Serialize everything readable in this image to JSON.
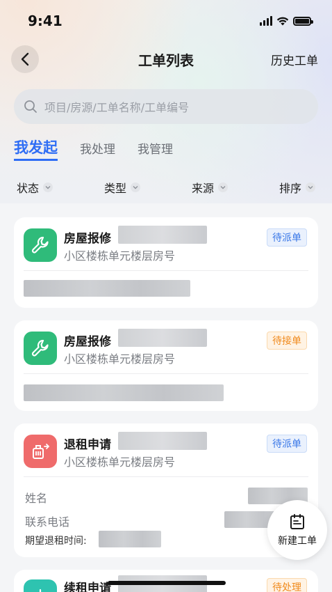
{
  "status_bar": {
    "time": "9:41"
  },
  "nav": {
    "title": "工单列表",
    "history": "历史工单"
  },
  "search": {
    "placeholder": "项目/房源/工单名称/工单编号"
  },
  "tabs": [
    "我发起",
    "我处理",
    "我管理"
  ],
  "filters": [
    "状态",
    "类型",
    "来源",
    "排序"
  ],
  "cards": [
    {
      "title": "房屋报修",
      "subtitle": "小区楼栋单元楼层房号",
      "status": "待派单",
      "icon": "wrench-icon"
    },
    {
      "title": "房屋报修",
      "subtitle": "小区楼栋单元楼层房号",
      "status": "待接单",
      "icon": "wrench-icon"
    },
    {
      "title": "退租申请",
      "subtitle": "小区楼栋单元楼层房号",
      "status": "待派单",
      "icon": "move-out-icon",
      "fields": {
        "name": "姓名",
        "phone": "联系电话",
        "expected_date": "期望退租时间:"
      }
    },
    {
      "title": "续租申请",
      "status": "待处理",
      "icon": "renew-icon"
    }
  ],
  "fab": {
    "label": "新建工单",
    "icon": "new-order-icon"
  },
  "colors": {
    "accent": "#2e6df5",
    "green_icon": "#2fbb7a",
    "red_icon": "#ef6b6b",
    "orange_badge": "#f08a1c"
  }
}
